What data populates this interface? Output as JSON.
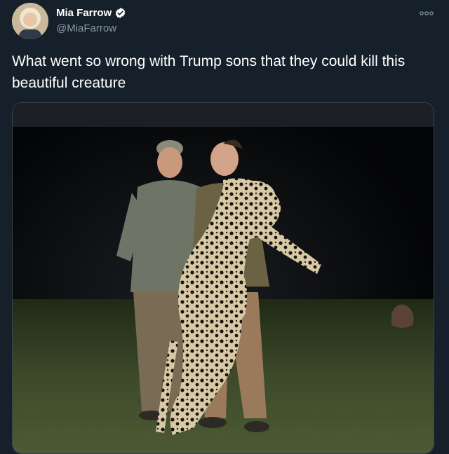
{
  "tweet": {
    "author": {
      "display_name": "Mia Farrow",
      "handle": "@MiaFarrow",
      "verified": true,
      "avatar_icon": "profile-photo"
    },
    "text": "What went so wrong with Trump sons that they could kill this beautiful creature",
    "more_icon": "more-options-icon",
    "media": {
      "type": "photo"
    }
  },
  "colors": {
    "background": "#15202b",
    "text_primary": "#ffffff",
    "text_secondary": "#8899a6",
    "verified_blue": "#1da1f2",
    "border": "#38444d"
  }
}
